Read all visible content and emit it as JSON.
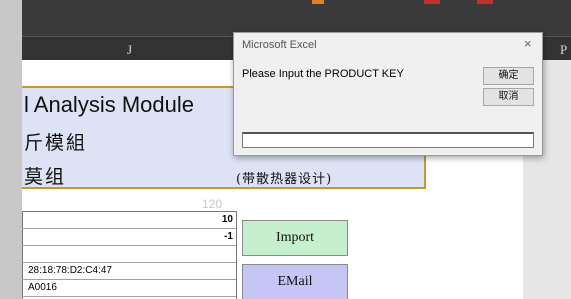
{
  "columns": {
    "j": "J",
    "p": "P"
  },
  "dialog": {
    "title": "Microsoft Excel",
    "close_glyph": "×",
    "message": "Please Input the PRODUCT KEY",
    "ok_label": "确定",
    "cancel_label": "取消",
    "input_value": ""
  },
  "sheet": {
    "title_en": "l Analysis Module",
    "title_cn_1": "斤模組",
    "title_cn_2": "莫组",
    "note_cn": "(带散热器设计)",
    "faint_number": "120",
    "cells": [
      "10",
      "-1",
      "",
      "28:18:78:D2:C4:47",
      "A0016"
    ],
    "import_label": "Import",
    "email_label": "EMail"
  },
  "colors": {
    "title_bg": "#dde3f5",
    "title_border": "#c49a2a",
    "import_bg": "#c6efce",
    "email_bg": "#c5c6f5"
  }
}
